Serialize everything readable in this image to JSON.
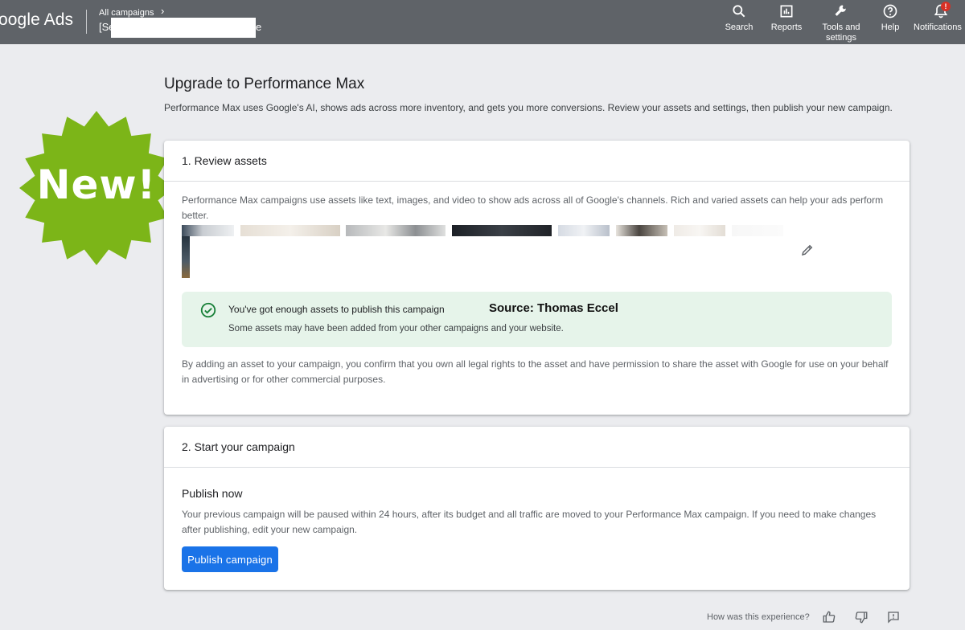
{
  "header": {
    "logo": "oogle Ads",
    "breadcrumb": "All campaigns",
    "campaign_name_start": "[Se",
    "campaign_name_end": "e",
    "nav": {
      "search": "Search",
      "reports": "Reports",
      "tools_line1": "Tools and",
      "tools_line2": "settings",
      "help": "Help",
      "notifications": "Notifications",
      "notifications_badge": "!"
    }
  },
  "page": {
    "title": "Upgrade to Performance Max",
    "description": "Performance Max uses Google's AI, shows ads across more inventory, and gets you more conversions. Review your assets and settings, then publish your new campaign."
  },
  "badge": {
    "text": "New!",
    "color": "#7cb518"
  },
  "review": {
    "heading": "1. Review assets",
    "description": "Performance Max campaigns use assets like text, images, and video to show ads across all of Google's channels. Rich and varied assets can help your ads perform better.",
    "success_title": "You've got enough assets to publish this campaign",
    "success_sub": "Some assets may have been added from your other campaigns and your website.",
    "source": "Source: Thomas Eccel",
    "legal": "By adding an asset to your campaign, you confirm that you own all legal rights to the asset and have permission to share the asset with Google for use on your behalf in advertising or for other commercial purposes."
  },
  "start": {
    "heading": "2. Start your campaign",
    "publish_heading": "Publish now",
    "publish_text": "Your previous campaign will be paused within 24 hours, after its budget and all traffic are moved to your Performance Max campaign. If you need to make changes after publishing, edit your new campaign.",
    "publish_button": "Publish campaign"
  },
  "feedback": {
    "question": "How was this experience?"
  },
  "colors": {
    "topbar": "#5f6368",
    "primary": "#1a73e8",
    "success_bg": "#e6f4ea",
    "success_icon": "#188038"
  }
}
